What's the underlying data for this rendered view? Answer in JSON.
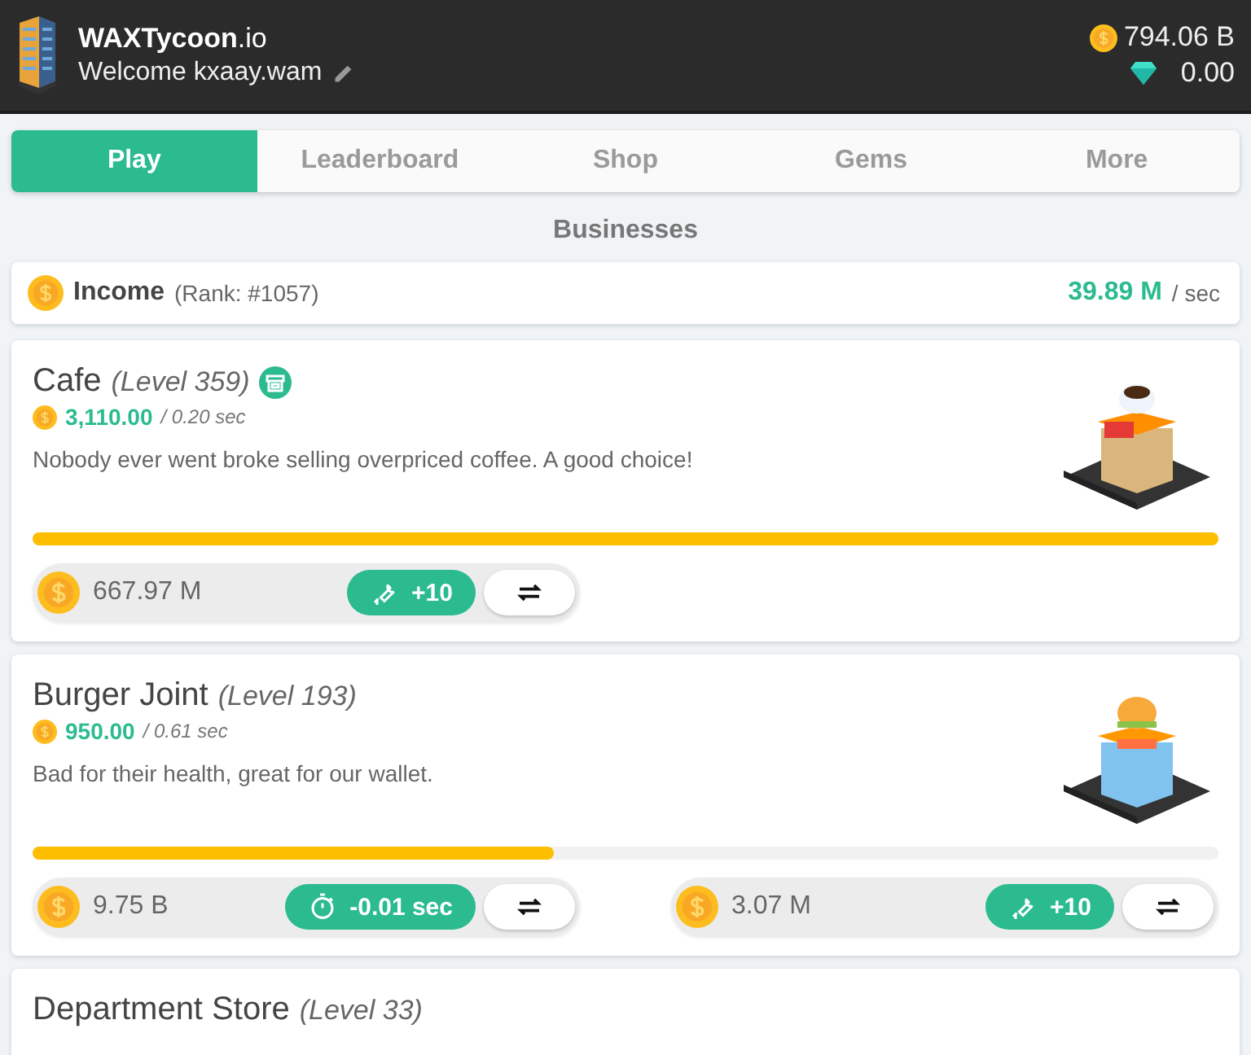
{
  "header": {
    "brand_bold": "WAXTycoon",
    "brand_suffix": ".io",
    "welcome": "Welcome kxaay.wam",
    "balance": "794.06 B",
    "gems": "0.00"
  },
  "tabs": [
    {
      "label": "Play",
      "selected": true
    },
    {
      "label": "Leaderboard",
      "selected": false
    },
    {
      "label": "Shop",
      "selected": false
    },
    {
      "label": "Gems",
      "selected": false
    },
    {
      "label": "More",
      "selected": false
    }
  ],
  "section_title": "Businesses",
  "income": {
    "label": "Income",
    "rank": "(Rank: #1057)",
    "amount": "39.89 M",
    "unit": "/ sec"
  },
  "businesses": [
    {
      "name": "Cafe",
      "level": "(Level 359)",
      "has_shop_badge": true,
      "kind": "cafe",
      "income": "3,110.00",
      "interval": "/ 0.20 sec",
      "description": "Nobody ever went broke selling overpriced coffee. A good choice!",
      "level_progress": {
        "level": 1.0
      },
      "upgrades": [
        {
          "kind": "upgrade",
          "cost": "667.97 M",
          "action": "+10"
        }
      ]
    },
    {
      "name": "Burger Joint",
      "level": "(Level 193)",
      "has_shop_badge": false,
      "kind": "burger",
      "income": "950.00",
      "interval": "/ 0.61 sec",
      "description": "Bad for their health, great for our wallet.",
      "level_progress": {
        "level": 0.44
      },
      "upgrades": [
        {
          "kind": "speed",
          "cost": "9.75 B",
          "action": "-0.01 sec"
        },
        {
          "kind": "upgrade",
          "cost": "3.07 M",
          "action": "+10"
        }
      ]
    },
    {
      "name": "Department Store",
      "level": "(Level 33)"
    }
  ]
}
